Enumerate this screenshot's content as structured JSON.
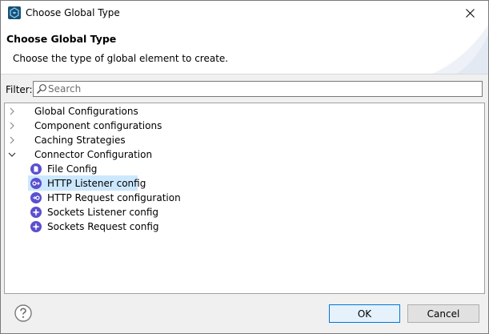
{
  "window": {
    "title": "Choose Global Type"
  },
  "header": {
    "title": "Choose Global Type",
    "description": "Choose the type of global element to create."
  },
  "filter": {
    "label": "Filter:",
    "placeholder": "Search",
    "value": ""
  },
  "tree": {
    "categories": [
      {
        "label": "Global Configurations",
        "expanded": false
      },
      {
        "label": "Component configurations",
        "expanded": false
      },
      {
        "label": "Caching Strategies",
        "expanded": false
      },
      {
        "label": "Connector Configuration",
        "expanded": true,
        "children": [
          {
            "label": "File Config",
            "icon": "file-config-icon"
          },
          {
            "label": "HTTP Listener config",
            "icon": "http-listener-icon",
            "selected": true
          },
          {
            "label": "HTTP Request configuration",
            "icon": "http-request-icon"
          },
          {
            "label": "Sockets Listener config",
            "icon": "sockets-listener-icon"
          },
          {
            "label": "Sockets Request config",
            "icon": "sockets-request-icon"
          }
        ]
      }
    ]
  },
  "buttons": {
    "ok": "OK",
    "cancel": "Cancel"
  },
  "colors": {
    "accent": "#0078d7",
    "selection": "#cce8ff",
    "connector_icon": "#5a4fcf"
  }
}
